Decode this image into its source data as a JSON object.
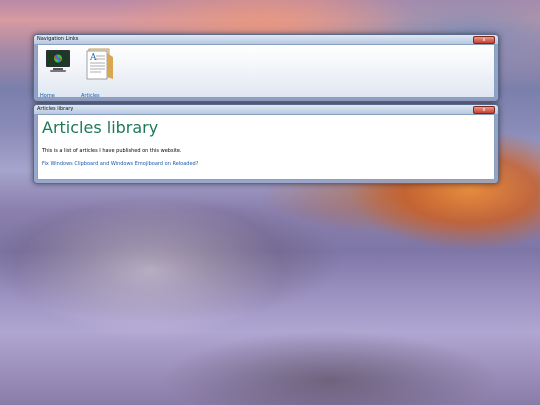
{
  "nav_window": {
    "title": "Navigation Links",
    "close_glyph": "x",
    "items": [
      {
        "label": "Home",
        "icon": "monitor-icon"
      },
      {
        "label": "Articles",
        "icon": "document-icon"
      }
    ]
  },
  "articles_window": {
    "title": "Articles library",
    "close_glyph": "x",
    "heading": "Articles library",
    "intro": "This is a list of articles I have published on this website.",
    "links": [
      "Fix Windows Clipboard and Windows Emojiboard on Reloaded?"
    ]
  },
  "colors": {
    "heading": "#1d7a55",
    "link": "#1a5aa8"
  }
}
